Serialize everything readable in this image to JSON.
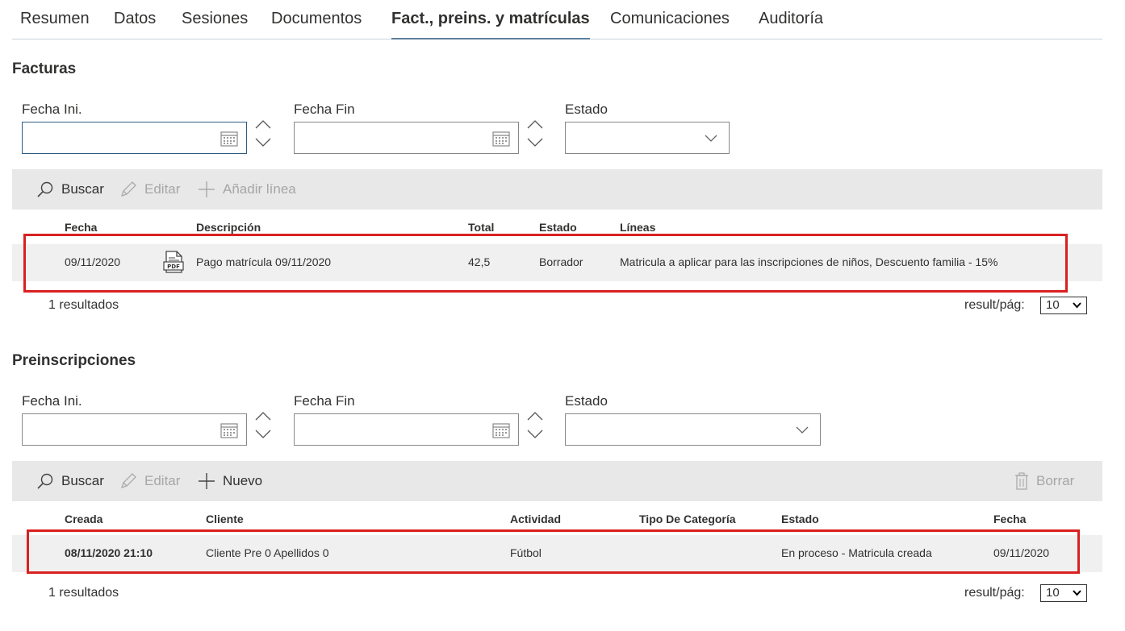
{
  "tabs": [
    {
      "label": "Resumen"
    },
    {
      "label": "Datos"
    },
    {
      "label": "Sesiones"
    },
    {
      "label": "Documentos"
    },
    {
      "label": "Fact., preins. y matrículas",
      "active": true
    },
    {
      "label": "Comunicaciones"
    },
    {
      "label": "Auditoría"
    }
  ],
  "facturas": {
    "title": "Facturas",
    "filters": {
      "fecha_ini_label": "Fecha Ini.",
      "fecha_ini_value": "",
      "fecha_fin_label": "Fecha Fin",
      "fecha_fin_value": "",
      "estado_label": "Estado",
      "estado_value": ""
    },
    "toolbar": {
      "buscar": "Buscar",
      "editar": "Editar",
      "anadir": "Añadir línea"
    },
    "columns": [
      "Fecha",
      "Descripción",
      "Total",
      "Estado",
      "Líneas"
    ],
    "rows": [
      {
        "fecha": "09/11/2020",
        "descripcion": "Pago matrícula 09/11/2020",
        "total": "42,5",
        "estado": "Borrador",
        "lineas": "Matricula a aplicar para las inscripciones de niños, Descuento familia - 15%"
      }
    ],
    "result_count": "1 resultados",
    "per_page_label": "result/pág:",
    "per_page_value": "10"
  },
  "preinscripciones": {
    "title": "Preinscripciones",
    "filters": {
      "fecha_ini_label": "Fecha Ini.",
      "fecha_ini_value": "",
      "fecha_fin_label": "Fecha Fin",
      "fecha_fin_value": "",
      "estado_label": "Estado",
      "estado_value": ""
    },
    "toolbar": {
      "buscar": "Buscar",
      "editar": "Editar",
      "nuevo": "Nuevo",
      "borrar": "Borrar"
    },
    "columns": [
      "Creada",
      "Cliente",
      "Actividad",
      "Tipo De Categoría",
      "Estado",
      "Fecha"
    ],
    "rows": [
      {
        "creada": "08/11/2020 21:10",
        "cliente": "Cliente Pre 0 Apellidos 0",
        "actividad": "Fútbol",
        "tipo_categoria": "",
        "estado": "En proceso - Matricula creada",
        "fecha": "09/11/2020"
      }
    ],
    "result_count": "1 resultados",
    "per_page_label": "result/pág:",
    "per_page_value": "10"
  },
  "colors": {
    "highlight": "#d92020",
    "tab_underline": "#5b7d9a",
    "toolbar_bg": "#e8e8e8",
    "row_bg": "#f0f0f0",
    "disabled_text": "#a6a6a6"
  }
}
